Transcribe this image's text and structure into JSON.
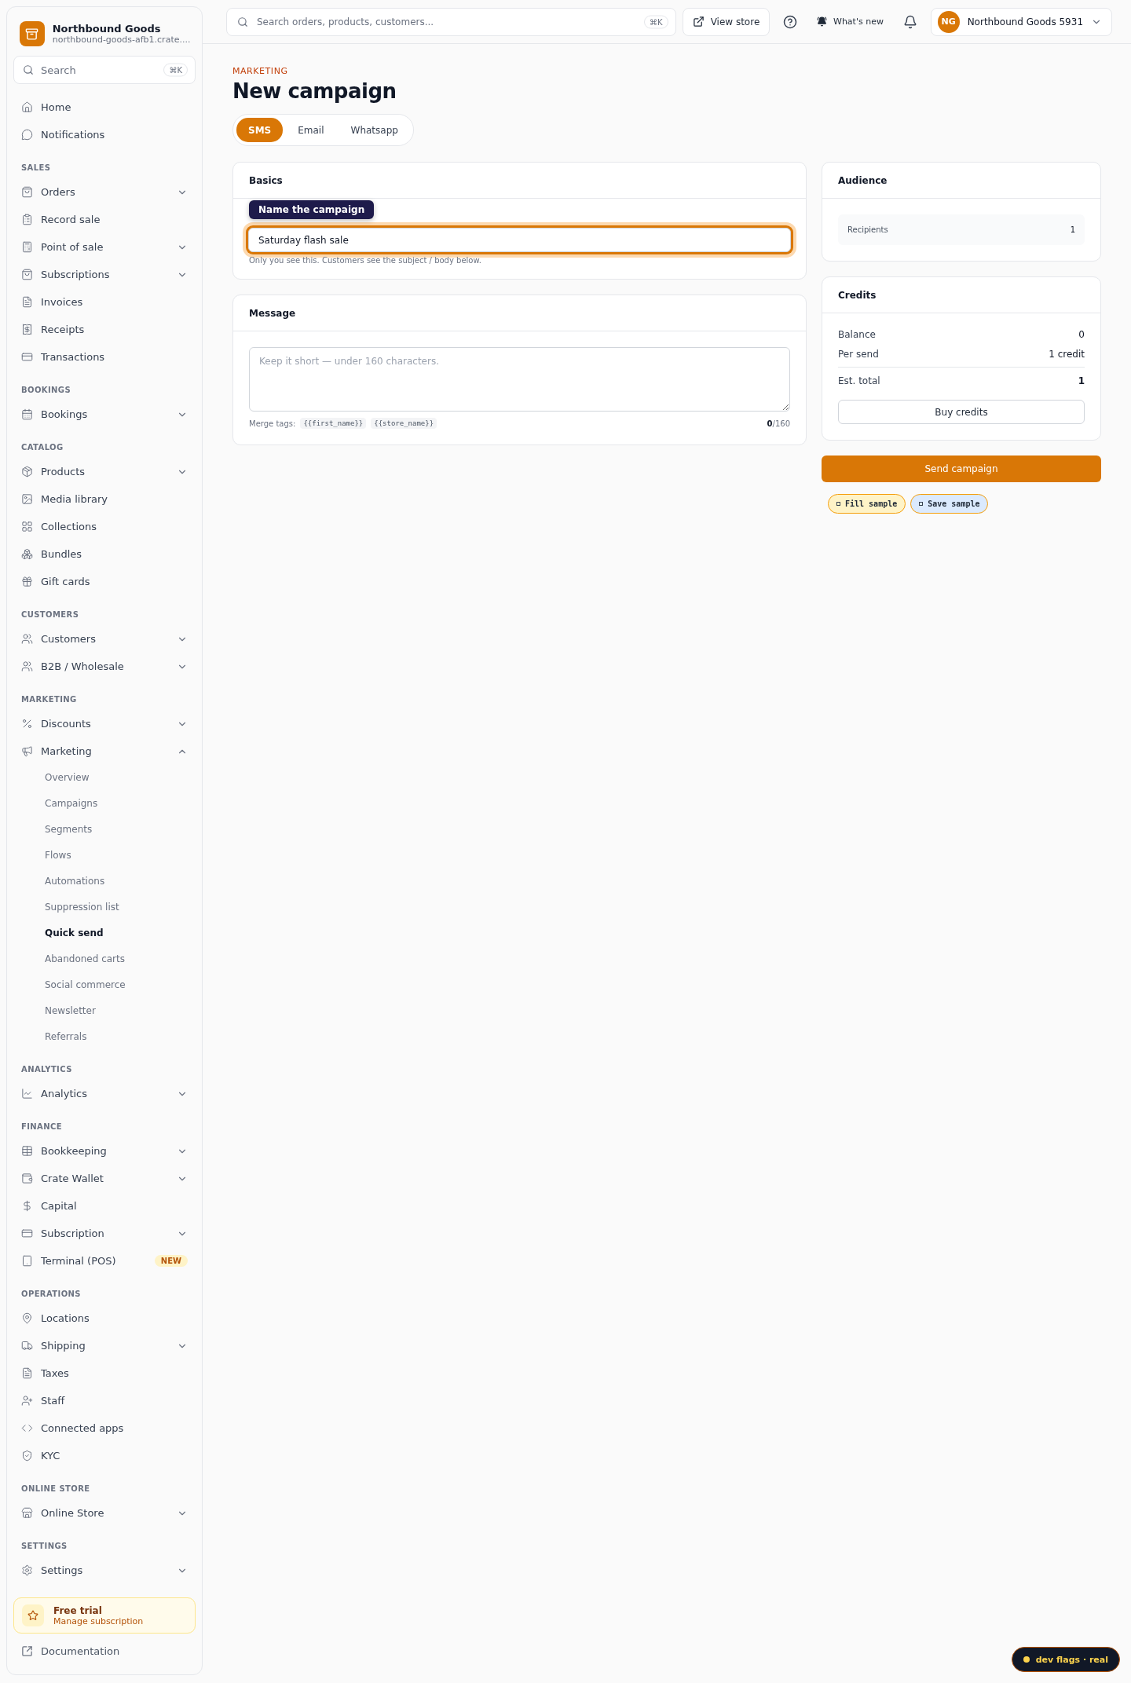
{
  "brand": {
    "name": "Northbound Goods",
    "url": "northbound-goods-afb1.crate...."
  },
  "sidebar_search": {
    "placeholder": "Search",
    "shortcut": "⌘K"
  },
  "sidebar": {
    "sections": [
      {
        "items": [
          {
            "label": "Home",
            "kind": "link",
            "selected": false
          },
          {
            "label": "Notifications",
            "kind": "link",
            "selected": false
          }
        ]
      },
      {
        "title": "SALES",
        "items": [
          {
            "label": "Orders",
            "kind": "group",
            "expanded": false,
            "selected": false
          },
          {
            "label": "Record sale",
            "kind": "link",
            "selected": false
          },
          {
            "label": "Point of sale",
            "kind": "group",
            "expanded": false,
            "selected": false
          },
          {
            "label": "Subscriptions",
            "kind": "group",
            "expanded": false,
            "selected": false
          },
          {
            "label": "Invoices",
            "kind": "link",
            "selected": false
          },
          {
            "label": "Receipts",
            "kind": "link",
            "selected": false
          },
          {
            "label": "Transactions",
            "kind": "link",
            "selected": false
          }
        ]
      },
      {
        "title": "BOOKINGS",
        "items": [
          {
            "label": "Bookings",
            "kind": "group",
            "expanded": false,
            "selected": false
          }
        ]
      },
      {
        "title": "CATALOG",
        "items": [
          {
            "label": "Products",
            "kind": "group",
            "expanded": false,
            "selected": false
          },
          {
            "label": "Media library",
            "kind": "link",
            "selected": false
          },
          {
            "label": "Collections",
            "kind": "link",
            "selected": false
          },
          {
            "label": "Bundles",
            "kind": "link",
            "selected": false
          },
          {
            "label": "Gift cards",
            "kind": "link",
            "selected": false
          }
        ]
      },
      {
        "title": "CUSTOMERS",
        "items": [
          {
            "label": "Customers",
            "kind": "group",
            "expanded": false,
            "selected": false
          },
          {
            "label": "B2B / Wholesale",
            "kind": "group",
            "expanded": false,
            "selected": false
          }
        ]
      },
      {
        "title": "MARKETING",
        "items": [
          {
            "label": "Discounts",
            "kind": "group",
            "expanded": false,
            "selected": false
          },
          {
            "label": "Marketing",
            "kind": "group",
            "expanded": true,
            "selected": false,
            "children": [
              {
                "label": "Overview",
                "selected": false
              },
              {
                "label": "Campaigns",
                "selected": false
              },
              {
                "label": "Segments",
                "selected": false
              },
              {
                "label": "Flows",
                "selected": false
              },
              {
                "label": "Automations",
                "selected": false
              },
              {
                "label": "Suppression list",
                "selected": false
              },
              {
                "label": "Quick send",
                "selected": true
              },
              {
                "label": "Abandoned carts",
                "selected": false
              },
              {
                "label": "Social commerce",
                "selected": false
              },
              {
                "label": "Newsletter",
                "selected": false
              },
              {
                "label": "Referrals",
                "selected": false
              }
            ]
          }
        ]
      },
      {
        "title": "ANALYTICS",
        "items": [
          {
            "label": "Analytics",
            "kind": "group",
            "expanded": false,
            "selected": false
          }
        ]
      },
      {
        "title": "FINANCE",
        "items": [
          {
            "label": "Bookkeeping",
            "kind": "group",
            "expanded": false,
            "selected": false
          },
          {
            "label": "Crate Wallet",
            "kind": "group",
            "expanded": false,
            "selected": false
          },
          {
            "label": "Capital",
            "kind": "link",
            "selected": false
          },
          {
            "label": "Subscription",
            "kind": "group",
            "expanded": false,
            "selected": false
          },
          {
            "label": "Terminal (POS)",
            "kind": "link",
            "selected": false,
            "badge": "NEW"
          }
        ]
      },
      {
        "title": "OPERATIONS",
        "items": [
          {
            "label": "Locations",
            "kind": "link",
            "selected": false
          },
          {
            "label": "Shipping",
            "kind": "group",
            "expanded": false,
            "selected": false
          },
          {
            "label": "Taxes",
            "kind": "link",
            "selected": false
          },
          {
            "label": "Staff",
            "kind": "link",
            "selected": false
          },
          {
            "label": "Connected apps",
            "kind": "link",
            "selected": false
          },
          {
            "label": "KYC",
            "kind": "link",
            "selected": false
          }
        ]
      },
      {
        "title": "ONLINE STORE",
        "items": [
          {
            "label": "Online Store",
            "kind": "group",
            "expanded": false,
            "selected": false
          }
        ]
      },
      {
        "title": "SETTINGS",
        "items": [
          {
            "label": "Settings",
            "kind": "group",
            "expanded": false,
            "selected": false
          }
        ]
      }
    ]
  },
  "trial": {
    "title": "Free trial",
    "link": "Manage subscription"
  },
  "documentation": "Documentation",
  "topbar": {
    "search_placeholder": "Search orders, products, customers...",
    "shortcut": "⌘K",
    "view_store": "View store",
    "whats_new": "What's new",
    "account": {
      "initials": "NG",
      "name": "Northbound Goods 5931"
    }
  },
  "page": {
    "eyebrow": "MARKETING",
    "title": "New campaign"
  },
  "tabs": [
    {
      "label": "SMS",
      "selected": true
    },
    {
      "label": "Email",
      "selected": false
    },
    {
      "label": "Whatsapp",
      "selected": false
    }
  ],
  "basics": {
    "title": "Basics",
    "value": "Saturday flash sale",
    "highlighted": true,
    "tooltip": "Name the campaign",
    "hint": "Only you see this. Customers see the subject / body below."
  },
  "message": {
    "title": "Message",
    "placeholder": "Keep it short — under 160 characters.",
    "merge_label": "Merge tags:",
    "merge_tags": [
      "{{first_name}}",
      "{{store_name}}"
    ],
    "count": "0",
    "limit": "/160"
  },
  "audience": {
    "title": "Audience",
    "label": "Recipients",
    "value": "1"
  },
  "credits": {
    "title": "Credits",
    "rows": [
      {
        "label": "Balance",
        "value": "0"
      },
      {
        "label": "Per send",
        "value": "1 credit"
      }
    ],
    "total": {
      "label": "Est. total",
      "value": "1"
    },
    "buy": "Buy credits"
  },
  "send": "Send campaign",
  "samples": [
    {
      "label": "Fill sample",
      "color": "#fef3c7"
    },
    {
      "label": "Save sample",
      "color": "#dbeafe"
    }
  ],
  "dev_flags": "dev flags · real"
}
